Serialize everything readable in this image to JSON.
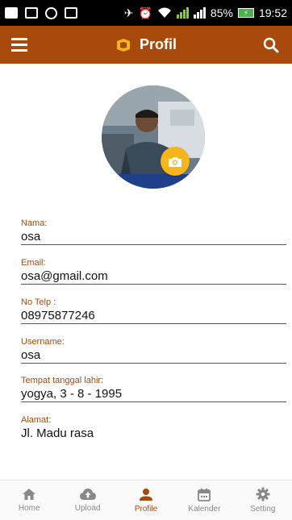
{
  "status_bar": {
    "battery_percent": "85%",
    "time": "19:52"
  },
  "app_bar": {
    "title": "Profil"
  },
  "colors": {
    "primary": "#a84a0c",
    "accent": "#f6b51c",
    "inactive_nav": "#888888"
  },
  "icons": {
    "menu": "hamburger-icon",
    "search": "search-icon",
    "camera": "camera-icon"
  },
  "profile": {
    "fields": [
      {
        "label": "Nama:",
        "value": "osa"
      },
      {
        "label": "Email:",
        "value": "osa@gmail.com"
      },
      {
        "label": "No Telp :",
        "value": "08975877246"
      },
      {
        "label": "Username:",
        "value": "osa"
      },
      {
        "label": "Tempat tanggal lahir:",
        "value": "yogya, 3 - 8 - 1995"
      },
      {
        "label": "Alamat:",
        "value": "Jl. Madu rasa"
      }
    ]
  },
  "bottom_nav": {
    "active": "Profile",
    "items": [
      {
        "label": "Home",
        "icon": "home-icon"
      },
      {
        "label": "Upload",
        "icon": "cloud-upload-icon"
      },
      {
        "label": "Profile",
        "icon": "person-icon"
      },
      {
        "label": "Kalender",
        "icon": "calendar-icon"
      },
      {
        "label": "Setting",
        "icon": "gear-icon"
      }
    ]
  }
}
